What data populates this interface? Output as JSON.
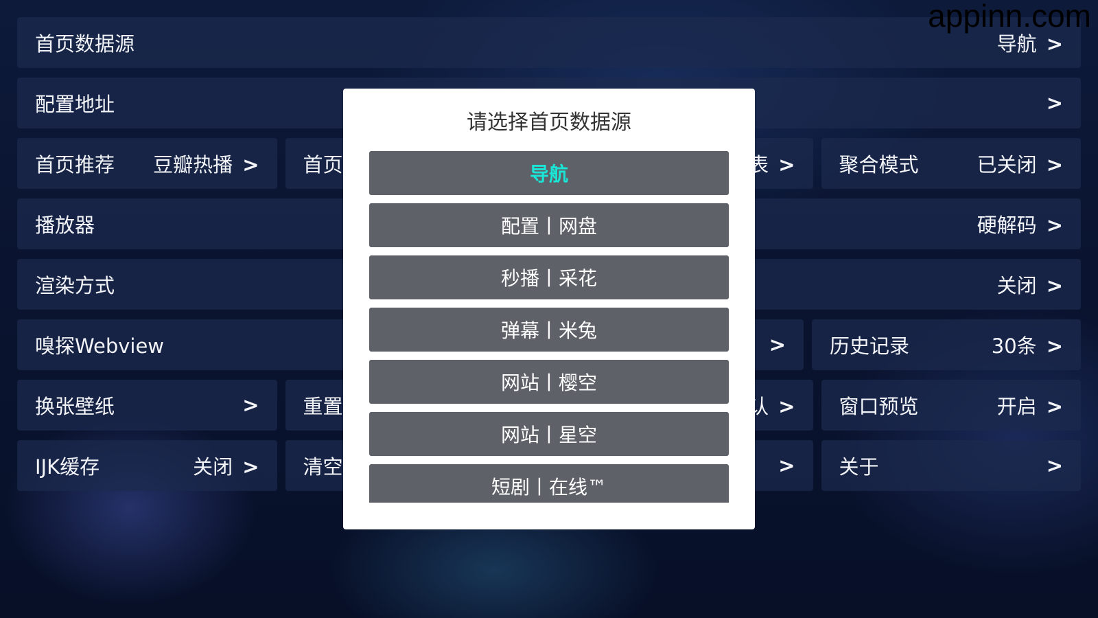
{
  "watermark": "appinn.com",
  "settings": {
    "rows": [
      [
        {
          "label": "首页数据源",
          "value": "导航",
          "arrow": ">"
        }
      ],
      [
        {
          "label": "配置地址",
          "value": "",
          "arrow": ">"
        }
      ],
      [
        {
          "label": "首页推荐",
          "value": "豆瓣热播",
          "arrow": ">"
        },
        {
          "label": "首页",
          "value": "",
          "arrow": ""
        },
        {
          "label": "",
          "value": "表",
          "arrow": ">"
        },
        {
          "label": "聚合模式",
          "value": "已关闭",
          "arrow": ">"
        }
      ],
      [
        {
          "label": "播放器",
          "value": "硬解码",
          "arrow": ">"
        }
      ],
      [
        {
          "label": "渲染方式",
          "value": "关闭",
          "arrow": ">"
        }
      ],
      [
        {
          "label": "嗅探Webview",
          "value": "",
          "arrow": ""
        },
        {
          "label": "",
          "value": "",
          "arrow": ">"
        },
        {
          "label": "历史记录",
          "value": "30条",
          "arrow": ">"
        }
      ],
      [
        {
          "label": "换张壁纸",
          "value": "",
          "arrow": ">"
        },
        {
          "label": "重置",
          "value": "",
          "arrow": ""
        },
        {
          "label": "",
          "value": "认",
          "arrow": ">"
        },
        {
          "label": "窗口预览",
          "value": "开启",
          "arrow": ">"
        }
      ],
      [
        {
          "label": "IJK缓存",
          "value": "关闭",
          "arrow": ">"
        },
        {
          "label": "清空",
          "value": "",
          "arrow": ""
        },
        {
          "label": "",
          "value": "",
          "arrow": ">"
        },
        {
          "label": "关于",
          "value": "",
          "arrow": ">"
        }
      ]
    ]
  },
  "dialog": {
    "title": "请选择首页数据源",
    "options": [
      {
        "label": "导航",
        "selected": true
      },
      {
        "label": "配置丨网盘",
        "selected": false
      },
      {
        "label": "秒播丨采花",
        "selected": false
      },
      {
        "label": "弹幕丨米兔",
        "selected": false
      },
      {
        "label": "网站丨樱空",
        "selected": false
      },
      {
        "label": "网站丨星空",
        "selected": false
      },
      {
        "label": "短剧丨在线™",
        "selected": false
      }
    ]
  }
}
